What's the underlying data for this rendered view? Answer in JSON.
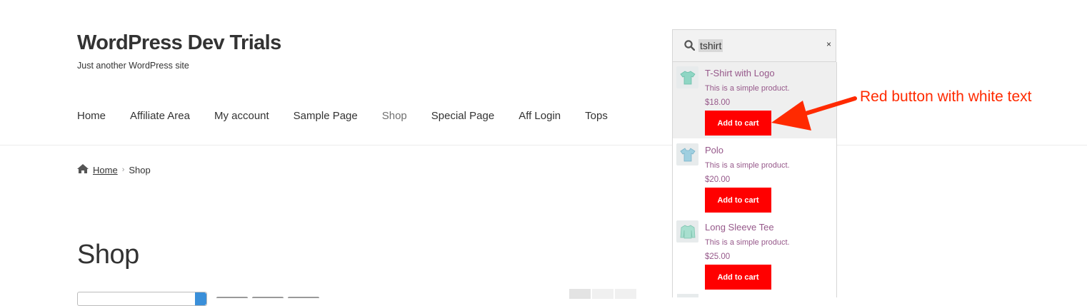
{
  "site": {
    "title": "WordPress Dev Trials",
    "tagline": "Just another WordPress site"
  },
  "nav": {
    "items": [
      "Home",
      "Affiliate Area",
      "My account",
      "Sample Page",
      "Shop",
      "Special Page",
      "Aff Login",
      "Tops"
    ],
    "active": "Shop"
  },
  "breadcrumb": {
    "home": "Home",
    "current": "Shop"
  },
  "page": {
    "heading": "Shop"
  },
  "search": {
    "query": "tshirt",
    "clear_label": "×"
  },
  "results": [
    {
      "name": "T-Shirt with Logo",
      "description": "This is a simple product.",
      "price": "$18.00",
      "button": "Add to cart"
    },
    {
      "name": "Polo",
      "description": "This is a simple product.",
      "price": "$20.00",
      "button": "Add to cart"
    },
    {
      "name": "Long Sleeve Tee",
      "description": "This is a simple product.",
      "price": "$25.00",
      "button": "Add to cart"
    }
  ],
  "annotation": {
    "text": "Red button with white text"
  },
  "colors": {
    "button_bg": "#ff0000",
    "button_text": "#ffffff",
    "product_link": "#96588a",
    "annotation": "#ff2a00"
  },
  "icons": {
    "home": "home-icon",
    "search": "search-icon",
    "clear": "close-icon",
    "arrow": "arrow-icon",
    "product": "shirt-icon"
  }
}
